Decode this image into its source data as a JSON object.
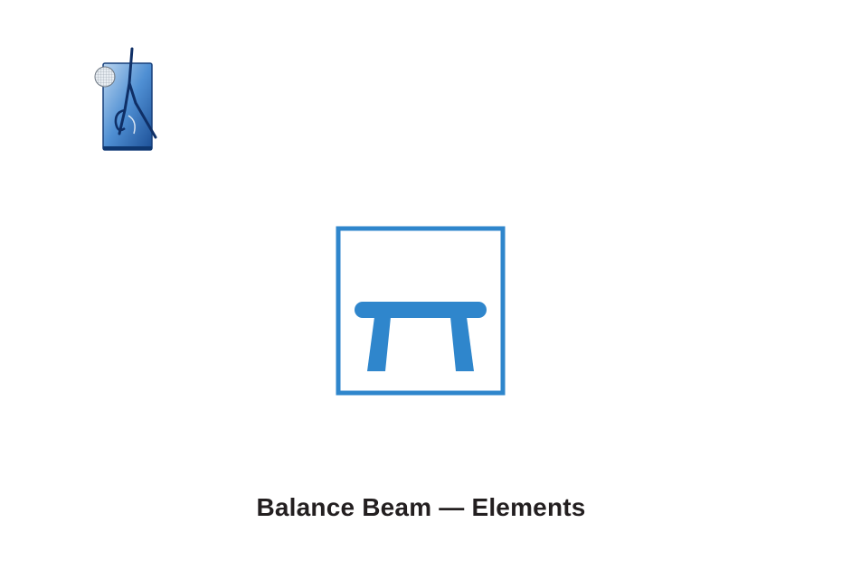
{
  "page": {
    "title": "Balance Beam — Elements"
  },
  "logo": {
    "icon": "gymnast-emblem-icon"
  },
  "apparatus": {
    "icon": "balance-beam-icon"
  },
  "colors": {
    "accent": "#2f86cc",
    "logo_blue": "#1c5aa6",
    "title_text": "#231f20"
  }
}
